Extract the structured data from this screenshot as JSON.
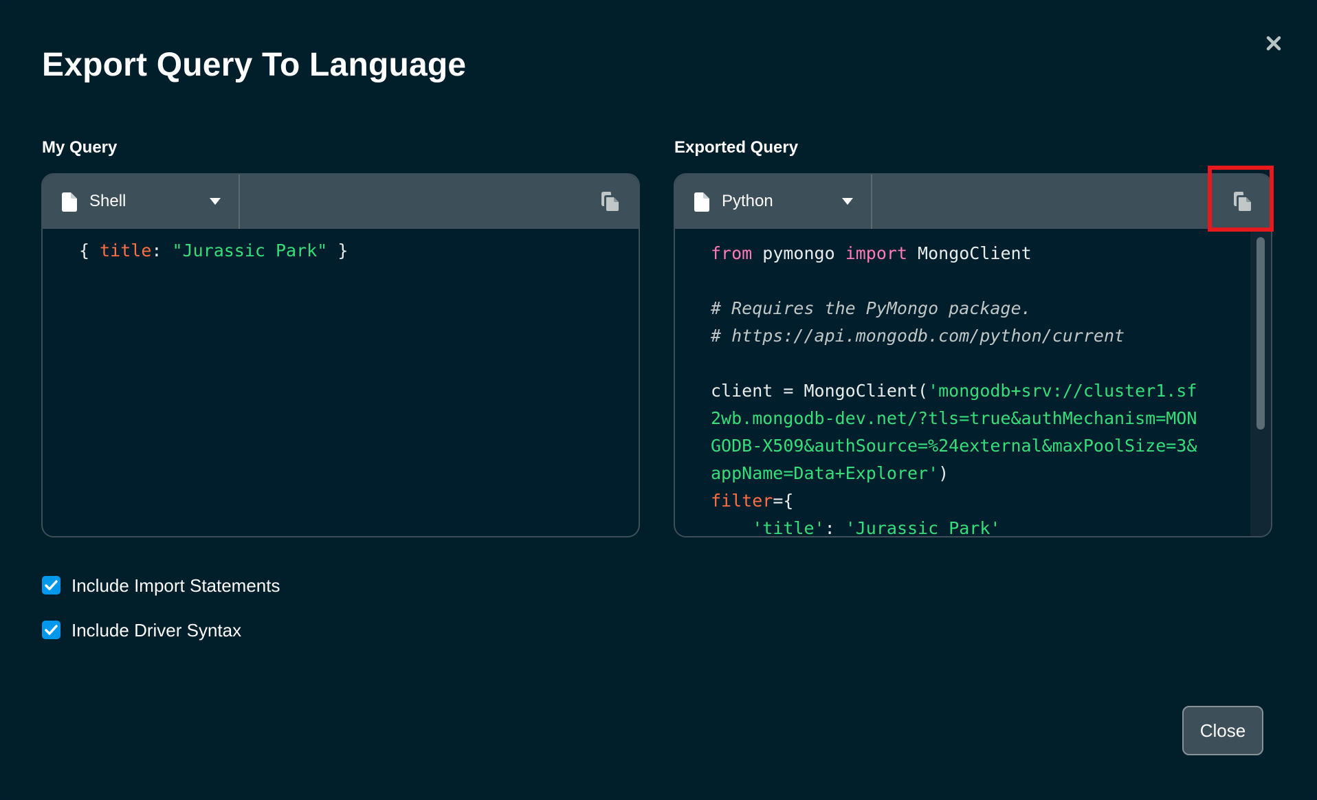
{
  "dialog": {
    "title": "Export Query To Language",
    "close_button_label": "Close"
  },
  "my_query": {
    "section_label": "My Query",
    "language": "Shell",
    "code_lines": [
      [
        {
          "t": "{ ",
          "c": "plain"
        },
        {
          "t": "title",
          "c": "key"
        },
        {
          "t": ": ",
          "c": "plain"
        },
        {
          "t": "\"Jurassic Park\"",
          "c": "str"
        },
        {
          "t": " }",
          "c": "plain"
        }
      ]
    ]
  },
  "exported_query": {
    "section_label": "Exported Query",
    "language": "Python",
    "code_lines": [
      [
        {
          "t": "from",
          "c": "kw"
        },
        {
          "t": " pymongo ",
          "c": "plain"
        },
        {
          "t": "import",
          "c": "kw"
        },
        {
          "t": " MongoClient",
          "c": "plain"
        }
      ],
      [],
      [
        {
          "t": "# Requires the PyMongo package.",
          "c": "cmt"
        }
      ],
      [
        {
          "t": "# https://api.mongodb.com/python/current",
          "c": "cmt"
        }
      ],
      [],
      [
        {
          "t": "client = MongoClient(",
          "c": "plain"
        },
        {
          "t": "'mongodb+srv://cluster1.sf",
          "c": "str"
        }
      ],
      [
        {
          "t": "2wb.mongodb-dev.net/?tls=true&authMechanism=MON",
          "c": "str"
        }
      ],
      [
        {
          "t": "GODB-X509&authSource=%24external&maxPoolSize=3&",
          "c": "str"
        }
      ],
      [
        {
          "t": "appName=Data+Explorer'",
          "c": "str"
        },
        {
          "t": ")",
          "c": "plain"
        }
      ],
      [
        {
          "t": "filter",
          "c": "key"
        },
        {
          "t": "={",
          "c": "plain"
        }
      ],
      [
        {
          "t": "    ",
          "c": "plain"
        },
        {
          "t": "'title'",
          "c": "str"
        },
        {
          "t": ": ",
          "c": "plain"
        },
        {
          "t": "'Jurassic Park'",
          "c": "str"
        }
      ]
    ]
  },
  "options": {
    "include_import_statements": {
      "label": "Include Import Statements",
      "checked": true
    },
    "include_driver_syntax": {
      "label": "Include Driver Syntax",
      "checked": true
    }
  },
  "colors": {
    "background": "#011e2b",
    "panel_header": "#3d4f58",
    "keyword": "#ff7ab8",
    "string": "#35de7b",
    "key": "#ff6f44",
    "checkbox": "#0498ec",
    "highlight": "#e8191c"
  },
  "icons": {
    "close": "close-x-icon",
    "file": "file-icon",
    "caret": "caret-down-icon",
    "copy": "copy-icon",
    "check": "check-icon"
  }
}
